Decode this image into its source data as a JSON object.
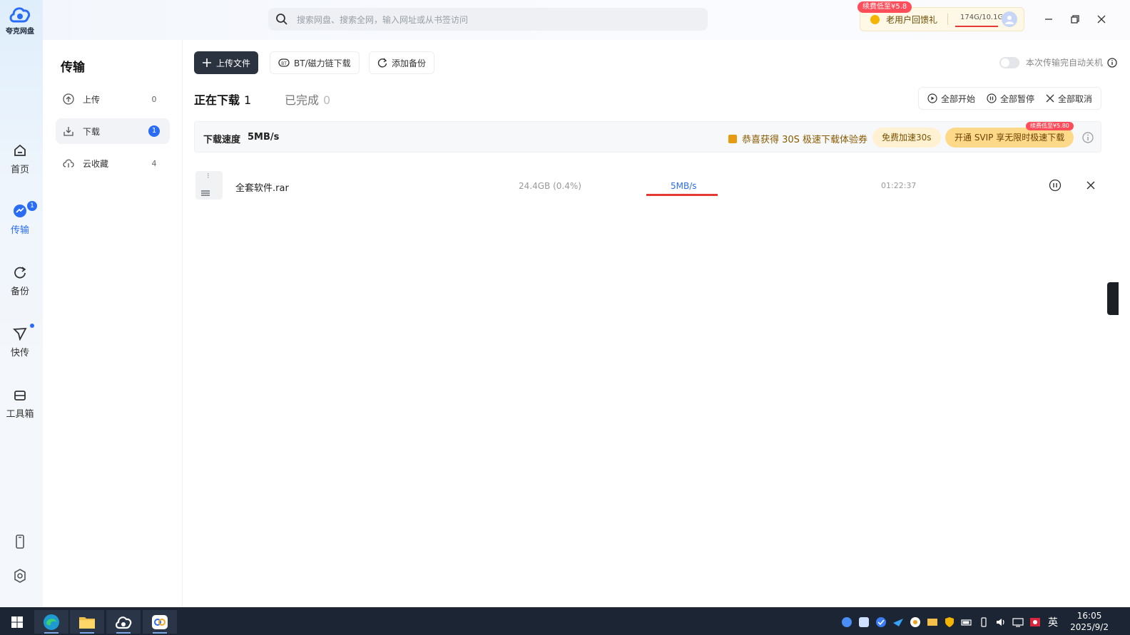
{
  "app": {
    "name": "夸克网盘",
    "search_placeholder": "搜索网盘、搜索全网，输入网址或从书签访问"
  },
  "rail": {
    "items": [
      {
        "label": "首页",
        "active": false
      },
      {
        "label": "传输",
        "active": true,
        "badge": "1"
      },
      {
        "label": "备份",
        "active": false
      },
      {
        "label": "快传",
        "active": false,
        "dot": true
      },
      {
        "label": "工具箱",
        "active": false
      }
    ]
  },
  "promo": {
    "tag": "续费低至¥5.8",
    "text": "老用户回馈礼",
    "quota": "174G/10.1G",
    "quota_fill": 1.0
  },
  "side": {
    "title": "传输",
    "items": [
      {
        "label": "上传",
        "count": "0",
        "active": false
      },
      {
        "label": "下载",
        "count": "1",
        "active": true
      },
      {
        "label": "云收藏",
        "count": "4",
        "active": false
      }
    ]
  },
  "toolbar": {
    "upload": "上传文件",
    "bt": "BT/磁力链下载",
    "backup": "添加备份",
    "auto_shutdown": "本次传输完自动关机",
    "auto_shutdown_on": false
  },
  "tabs": [
    {
      "label": "正在下载",
      "count": "1",
      "active": true
    },
    {
      "label": "已完成",
      "count": "0",
      "active": false
    }
  ],
  "bulk": {
    "start": "全部开始",
    "pause": "全部暂停",
    "cancel": "全部取消"
  },
  "speedbar": {
    "label": "下载速度",
    "value": "5MB/s",
    "coupon": "恭喜获得 30S 极速下载体验券",
    "free": "免费加速30s",
    "svip": "开通 SVIP 享无限时极速下载",
    "svip_tag": "续费低至¥5.80"
  },
  "downloads": [
    {
      "name": "全套软件.rar",
      "size": "24.4GB (0.4%)",
      "speed": "5MB/s",
      "eta": "01:22:37",
      "progress": 0.004
    }
  ],
  "taskbar": {
    "ime": "英",
    "time": "16:05",
    "date": "2025/9/2"
  },
  "colors": {
    "accent": "#2a6cf6",
    "primary_button": "#2b3340",
    "progress_red": "#e53935"
  }
}
